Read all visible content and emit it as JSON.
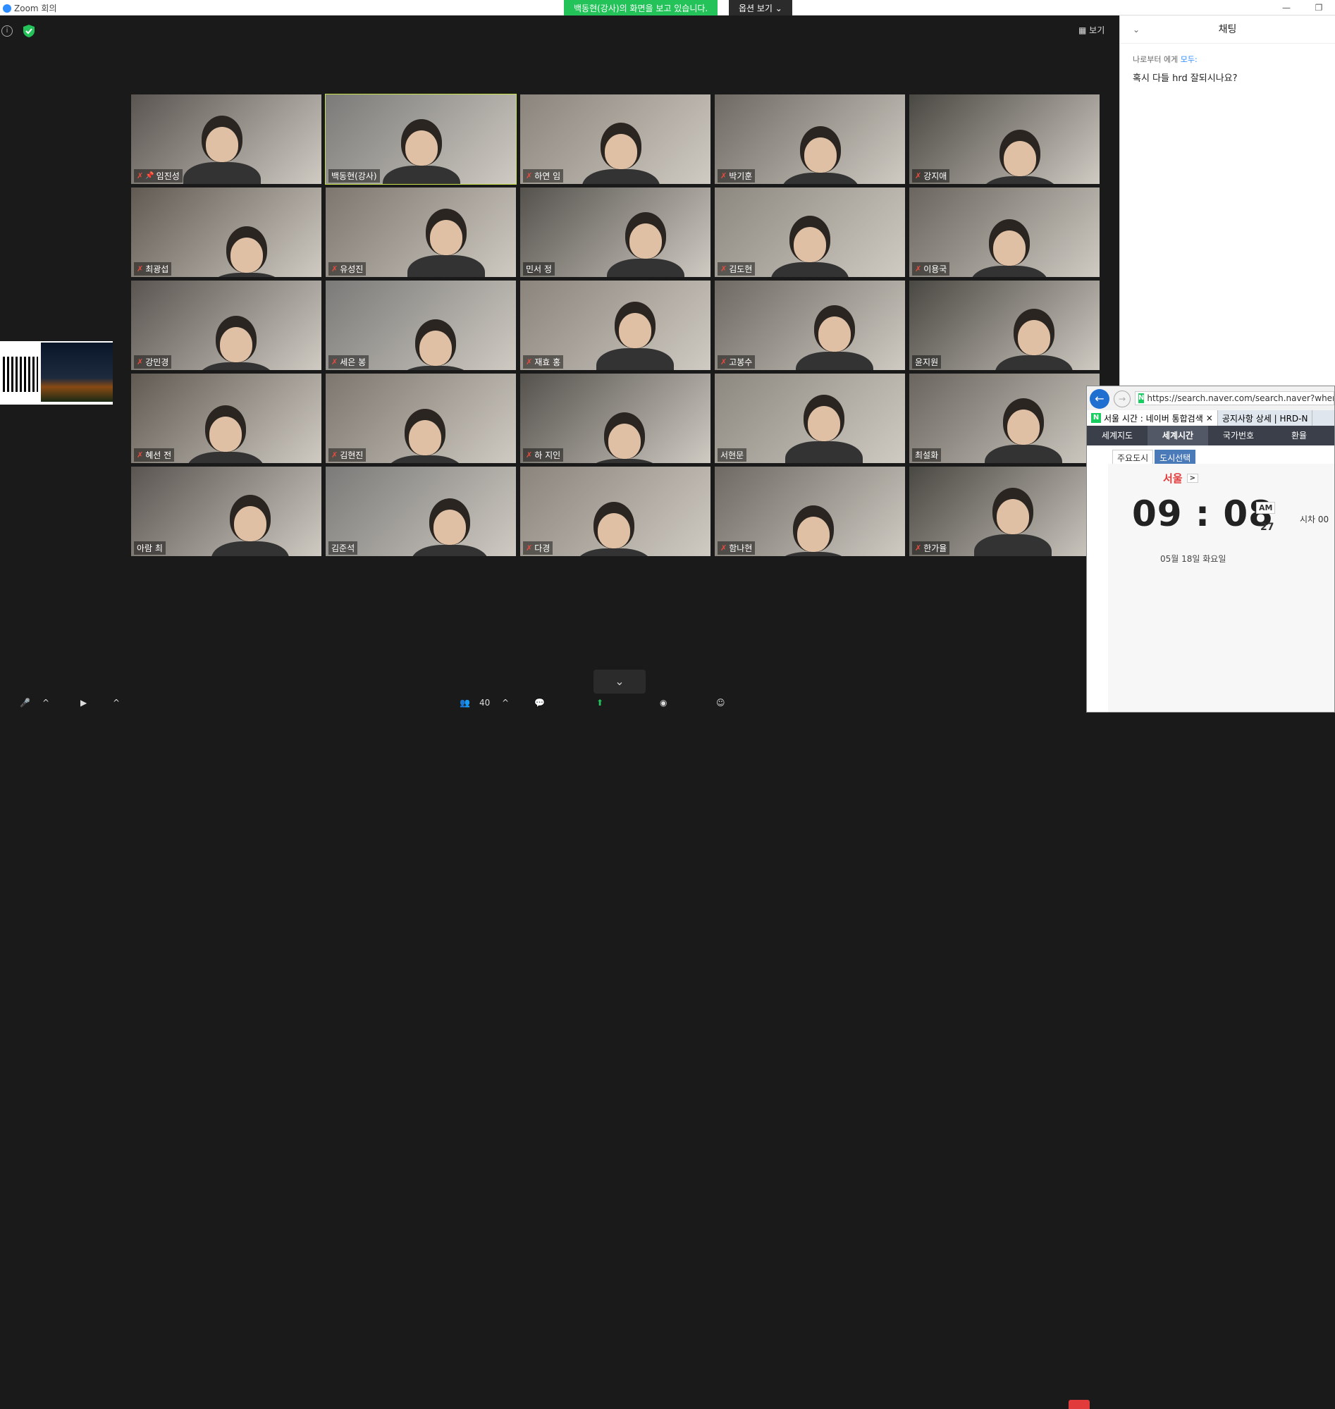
{
  "window": {
    "app_title": "Zoom 회의",
    "share_banner": "백동현(강사)의 화면을 보고 있습니다.",
    "view_options": "옵션 보기 ⌄",
    "minimize": "—",
    "restore": "❐"
  },
  "meeting": {
    "view_label": "▦ 보기",
    "info_glyph": "i",
    "chevron_down": "⌄"
  },
  "participants": [
    {
      "name": "임진성",
      "muted": true,
      "pinned": true
    },
    {
      "name": "백동현(강사)",
      "muted": false,
      "active": true
    },
    {
      "name": "하연 임",
      "muted": true
    },
    {
      "name": "박기훈",
      "muted": true
    },
    {
      "name": "강지애",
      "muted": true
    },
    {
      "name": "최광섭",
      "muted": true
    },
    {
      "name": "유성진",
      "muted": true
    },
    {
      "name": "민서 정",
      "muted": false
    },
    {
      "name": "김도현",
      "muted": true
    },
    {
      "name": "이용국",
      "muted": true
    },
    {
      "name": "강민경",
      "muted": true
    },
    {
      "name": "세은 봉",
      "muted": true
    },
    {
      "name": "재효 홍",
      "muted": true
    },
    {
      "name": "고봉수",
      "muted": true
    },
    {
      "name": "윤지원",
      "muted": false
    },
    {
      "name": "혜선 전",
      "muted": true
    },
    {
      "name": "김현진",
      "muted": true
    },
    {
      "name": "하 지인",
      "muted": true
    },
    {
      "name": "서현문",
      "muted": false
    },
    {
      "name": "최설화",
      "muted": false
    },
    {
      "name": "아람 최",
      "muted": false
    },
    {
      "name": "김준석",
      "muted": false
    },
    {
      "name": "다경",
      "muted": true
    },
    {
      "name": "함나현",
      "muted": true
    },
    {
      "name": "한가율",
      "muted": true
    }
  ],
  "toolbar": {
    "participants_count": "40",
    "caret": "^"
  },
  "chat": {
    "title": "채팅",
    "chevron": "⌄",
    "from_label": "나로부터 에게",
    "to_label": "모두:",
    "message": "혹시 다들 hrd 잘되시나요?"
  },
  "browser": {
    "url": "https://search.naver.com/search.naver?where=n",
    "tab1": "서울 시간 : 네이버 통합검색",
    "tab1_close": "×",
    "tab2": "공지사항 상세 | HRD-N",
    "nav_tabs": [
      "세계지도",
      "세계시간",
      "국가번호",
      "환율"
    ],
    "sub_tabs": [
      "주요도시",
      "도시선택"
    ],
    "city": "서울",
    "city_arrow": ">",
    "time": "09 : 08",
    "ampm": "AM",
    "seconds": "27",
    "diff_label": "시차 00",
    "date": "05월 18일   화요일"
  },
  "colors": {
    "accent": "#2d8cff",
    "active_outline": "#c8e34a",
    "banner": "#23c35a",
    "mute": "#e74c3c"
  }
}
